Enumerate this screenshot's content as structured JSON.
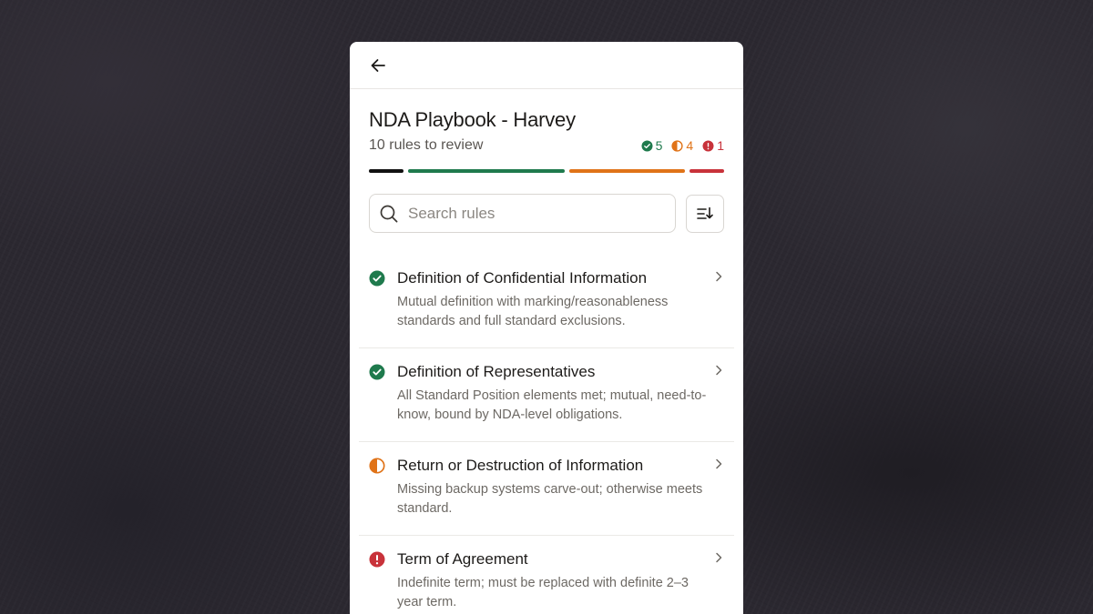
{
  "title": "NDA Playbook - Harvey",
  "subtitle": "10 rules to review",
  "counts": {
    "pass": "5",
    "partial": "4",
    "fail": "1"
  },
  "progress": {
    "segments": [
      {
        "name": "reviewed",
        "fraction": 0.1,
        "color": "#111111"
      },
      {
        "name": "pass",
        "fraction": 0.45,
        "color": "#1f7a4d"
      },
      {
        "name": "partial",
        "fraction": 0.33,
        "color": "#e07318"
      },
      {
        "name": "fail",
        "fraction": 0.1,
        "color": "#c8323a"
      }
    ]
  },
  "colors": {
    "pass": "#1f7a4d",
    "partial": "#e07318",
    "fail": "#c8323a"
  },
  "search": {
    "placeholder": "Search rules",
    "value": ""
  },
  "icons": {
    "back": "arrow-left-icon",
    "search": "search-icon",
    "sort": "sort-icon",
    "chevron": "chevron-right-icon"
  },
  "rules": [
    {
      "status": "pass",
      "title": "Definition of Confidential Information",
      "description": "Mutual definition with marking/reasonableness standards and full standard exclusions."
    },
    {
      "status": "pass",
      "title": "Definition of Representatives",
      "description": "All Standard Position elements met; mutual, need-to-know, bound by NDA-level obligations."
    },
    {
      "status": "partial",
      "title": "Return or Destruction of Information",
      "description": "Missing backup systems carve-out; otherwise meets standard."
    },
    {
      "status": "fail",
      "title": "Term of Agreement",
      "description": "Indefinite term; must be replaced with definite 2–3 year term."
    }
  ]
}
